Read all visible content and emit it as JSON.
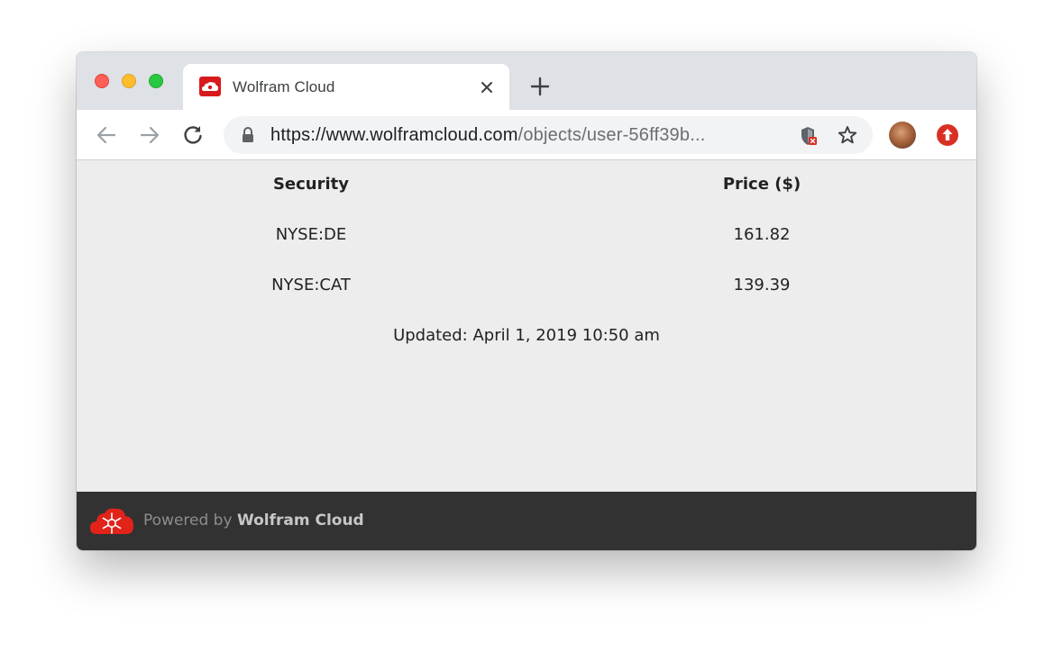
{
  "browser": {
    "tab": {
      "title": "Wolfram Cloud",
      "favicon": "wolfram-cloud-icon"
    },
    "toolbar": {
      "url_host": "https://www.wolframcloud.com",
      "url_path": "/objects/user-56ff39b...",
      "icons": [
        "back-arrow-icon",
        "forward-arrow-icon",
        "reload-icon",
        "lock-icon",
        "shield-blocked-icon",
        "bookmark-star-icon",
        "profile-avatar",
        "extension-upload-icon"
      ]
    }
  },
  "table": {
    "headers": [
      "Security",
      "Price ($)"
    ],
    "rows": [
      [
        "NYSE:DE",
        "161.82"
      ],
      [
        "NYSE:CAT",
        "139.39"
      ]
    ]
  },
  "updated": "Updated: April 1, 2019 10:50 am",
  "footer": {
    "powered_by": "Powered by ",
    "brand": "Wolfram Cloud"
  },
  "colors": {
    "wolfram_red": "#d7191c",
    "footer_bg": "#323232",
    "content_bg": "#ededed"
  }
}
